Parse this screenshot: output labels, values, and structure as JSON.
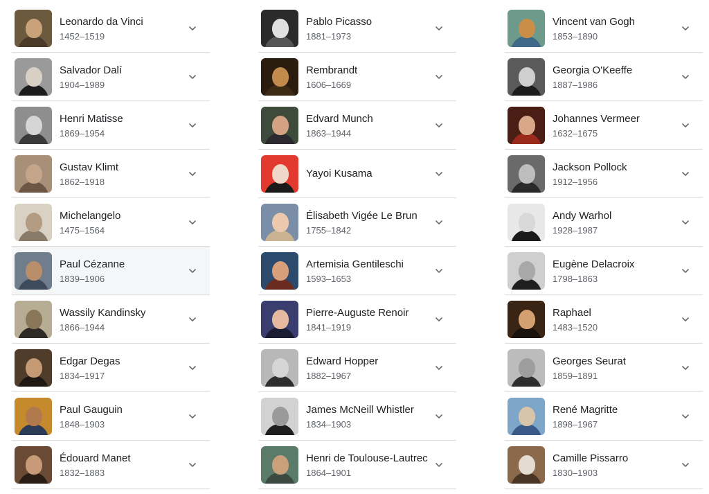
{
  "columns": [
    [
      {
        "name": "Leonardo da Vinci",
        "years": "1452–1519",
        "bg": "#6b5a3e",
        "skin": "#c9a27a",
        "cloth": "#4a3a28"
      },
      {
        "name": "Salvador Dalí",
        "years": "1904–1989",
        "bg": "#9a9a9a",
        "skin": "#d8d0c4",
        "cloth": "#1c1c1c"
      },
      {
        "name": "Henri Matisse",
        "years": "1869–1954",
        "bg": "#8e8e8e",
        "skin": "#d5d5d5",
        "cloth": "#3a3a3a"
      },
      {
        "name": "Gustav Klimt",
        "years": "1862–1918",
        "bg": "#a88f78",
        "skin": "#c4a58a",
        "cloth": "#6e5646"
      },
      {
        "name": "Michelangelo",
        "years": "1475–1564",
        "bg": "#d9d1c3",
        "skin": "#b49c82",
        "cloth": "#8a7b68"
      },
      {
        "name": "Paul Cézanne",
        "years": "1839–1906",
        "bg": "#6f7d8c",
        "skin": "#b98e6a",
        "cloth": "#3d4a5c",
        "highlight": true
      },
      {
        "name": "Wassily Kandinsky",
        "years": "1866–1944",
        "bg": "#b7ad95",
        "skin": "#8a7658",
        "cloth": "#2e2a24"
      },
      {
        "name": "Edgar Degas",
        "years": "1834–1917",
        "bg": "#4f3c2b",
        "skin": "#c49a74",
        "cloth": "#1f1812"
      },
      {
        "name": "Paul Gauguin",
        "years": "1848–1903",
        "bg": "#c48a2c",
        "skin": "#b07a4c",
        "cloth": "#2c3b56"
      },
      {
        "name": "Édouard Manet",
        "years": "1832–1883",
        "bg": "#6a4a34",
        "skin": "#c79b78",
        "cloth": "#2a1d14"
      }
    ],
    [
      {
        "name": "Pablo Picasso",
        "years": "1881–1973",
        "bg": "#2b2b2b",
        "skin": "#e0e0e0",
        "cloth": "#555555"
      },
      {
        "name": "Rembrandt",
        "years": "1606–1669",
        "bg": "#2a1d10",
        "skin": "#c28a4c",
        "cloth": "#3d2a14"
      },
      {
        "name": "Edvard Munch",
        "years": "1863–1944",
        "bg": "#3e4a3a",
        "skin": "#d2a283",
        "cloth": "#2c2a30"
      },
      {
        "name": "Yayoi Kusama",
        "years": "",
        "bg": "#e23a2e",
        "skin": "#f0d8c8",
        "cloth": "#1a1a1a"
      },
      {
        "name": "Élisabeth Vigée Le Brun",
        "years": "1755–1842",
        "bg": "#7a8ea8",
        "skin": "#ecc8ac",
        "cloth": "#c9b390"
      },
      {
        "name": "Artemisia Gentileschi",
        "years": "1593–1653",
        "bg": "#2c4a6c",
        "skin": "#d8a07a",
        "cloth": "#6a2c20"
      },
      {
        "name": "Pierre-Auguste Renoir",
        "years": "1841–1919",
        "bg": "#3a3e6e",
        "skin": "#e6b8a0",
        "cloth": "#1a1c34"
      },
      {
        "name": "Edward Hopper",
        "years": "1882–1967",
        "bg": "#b8b8b8",
        "skin": "#d6d6d6",
        "cloth": "#2e2e2e"
      },
      {
        "name": "James McNeill Whistler",
        "years": "1834–1903",
        "bg": "#d2d2d2",
        "skin": "#9a9a9a",
        "cloth": "#1e1e1e"
      },
      {
        "name": "Henri de Toulouse-Lautrec",
        "years": "1864–1901",
        "bg": "#5a7a6a",
        "skin": "#c9a07a",
        "cloth": "#3a4a40"
      }
    ],
    [
      {
        "name": "Vincent van Gogh",
        "years": "1853–1890",
        "bg": "#6e9a8c",
        "skin": "#c98e48",
        "cloth": "#3e6a8a"
      },
      {
        "name": "Georgia O'Keeffe",
        "years": "1887–1986",
        "bg": "#5a5a5a",
        "skin": "#cfcfcf",
        "cloth": "#1c1c1c"
      },
      {
        "name": "Johannes Vermeer",
        "years": "1632–1675",
        "bg": "#4a1e14",
        "skin": "#d8a888",
        "cloth": "#9a2a1c"
      },
      {
        "name": "Jackson Pollock",
        "years": "1912–1956",
        "bg": "#6a6a6a",
        "skin": "#bdbdbd",
        "cloth": "#2a2a2a"
      },
      {
        "name": "Andy Warhol",
        "years": "1928–1987",
        "bg": "#e8e8e8",
        "skin": "#d8d8d8",
        "cloth": "#1a1a1a"
      },
      {
        "name": "Eugène Delacroix",
        "years": "1798–1863",
        "bg": "#cfcfcf",
        "skin": "#a8a8a8",
        "cloth": "#1e1e1e"
      },
      {
        "name": "Raphael",
        "years": "1483–1520",
        "bg": "#3a2414",
        "skin": "#d4a070",
        "cloth": "#1a120c"
      },
      {
        "name": "Georges Seurat",
        "years": "1859–1891",
        "bg": "#bcbcbc",
        "skin": "#9e9e9e",
        "cloth": "#2e2e2e"
      },
      {
        "name": "René Magritte",
        "years": "1898–1967",
        "bg": "#7ea6c8",
        "skin": "#d8c4a8",
        "cloth": "#3a5a8a"
      },
      {
        "name": "Camille Pissarro",
        "years": "1830–1903",
        "bg": "#8a6a4a",
        "skin": "#e4dcd0",
        "cloth": "#4a3424"
      }
    ]
  ]
}
